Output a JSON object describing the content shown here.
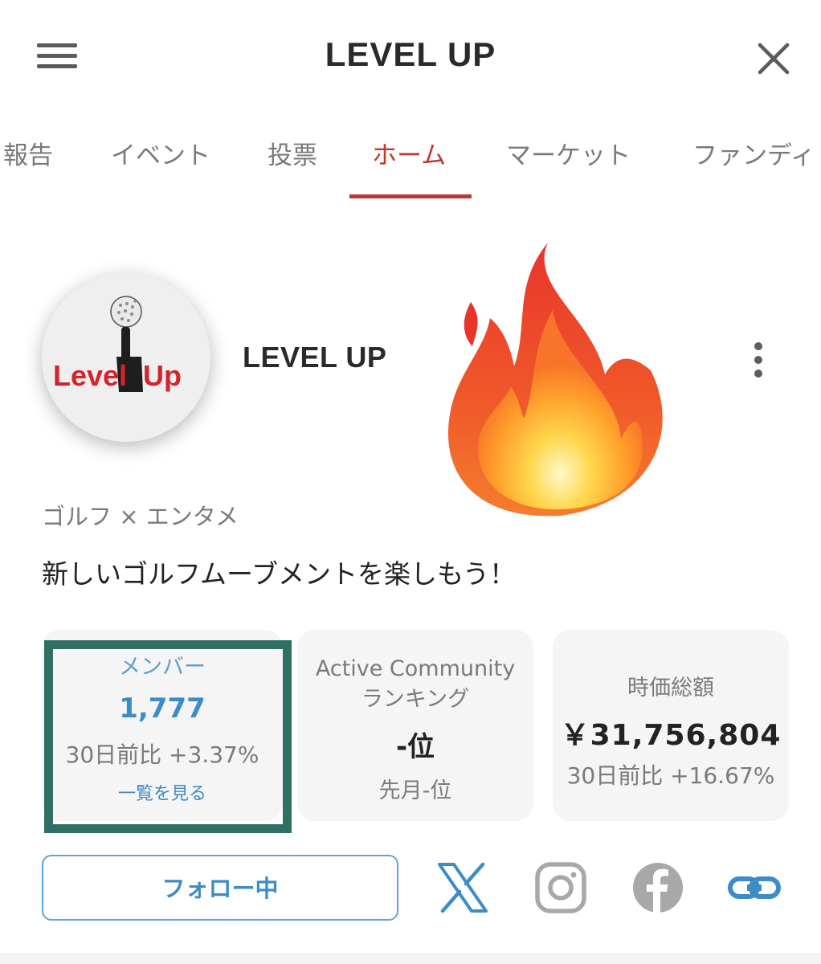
{
  "header": {
    "title": "LEVEL UP",
    "menu_icon": "hamburger-menu-icon",
    "close_icon": "close-x-icon"
  },
  "tabs": [
    {
      "label": "報告",
      "active": false
    },
    {
      "label": "イベント",
      "active": false
    },
    {
      "label": "投票",
      "active": false
    },
    {
      "label": "ホーム",
      "active": true
    },
    {
      "label": "マーケット",
      "active": false
    },
    {
      "label": "ファンディ",
      "active": false
    }
  ],
  "profile": {
    "avatar_logo_text": "Level Up",
    "name": "LEVEL UP",
    "category": "ゴルフ × エンタメ",
    "tagline": "新しいゴルフムーブメントを楽しもう！",
    "overlay_emoji": "fire"
  },
  "stats": {
    "members": {
      "label": "メンバー",
      "value": "1,777",
      "change": "30日前比 +3.37%",
      "link": "一覧を見る"
    },
    "ranking": {
      "label_line1": "Active Community",
      "label_line2": "ランキング",
      "value": "-位",
      "previous": "先月-位"
    },
    "market_cap": {
      "label": "時価総額",
      "value": "￥31,756,804",
      "change": "30日前比 +16.67%"
    }
  },
  "actions": {
    "follow_label": "フォロー中",
    "socials": [
      "x-icon",
      "instagram-icon",
      "facebook-icon",
      "link-icon"
    ]
  },
  "colors": {
    "accent_red": "#b93a32",
    "accent_blue": "#3d8cc7",
    "highlight_green": "#2f6f64"
  }
}
